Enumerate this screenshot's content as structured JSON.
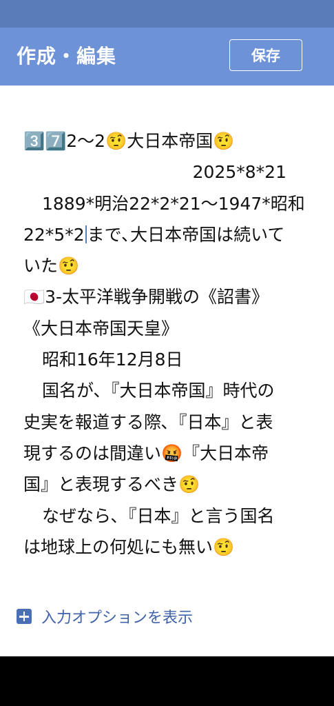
{
  "app_bar": {
    "title": "作成・編集",
    "save_label": "保存"
  },
  "editor": {
    "line1": "3️⃣7️⃣2〜2🤨大日本帝国🤨",
    "line2": "2025*8*21",
    "line3": "1889*明治22*2*21〜1947*昭和",
    "line4_before_caret": "22*5*2",
    "line4_after_caret": "まで､大日本帝国は続いて",
    "line5": "いた🤨",
    "line6": "🇯🇵3-太平洋戦争開戦の《詔書》",
    "line7": "《大日本帝国天皇》",
    "line8": "昭和16年12月8日",
    "line9": "国名が､『大日本帝国』時代の",
    "line10": "史実を報道する際､『日本』と表",
    "line11": "現するのは間違い🤬『大日本帝",
    "line12": "国』と表現するべき🤨",
    "line13": "なぜなら､『日本』と言う国名",
    "line14": "は地球上の何処にも無い🤨"
  },
  "options": {
    "label": "入力オプションを表示",
    "icon": "plus-icon"
  },
  "colors": {
    "status_bar": "#5a7cb8",
    "app_bar": "#6e92d8",
    "options_text": "#3f62a8"
  }
}
